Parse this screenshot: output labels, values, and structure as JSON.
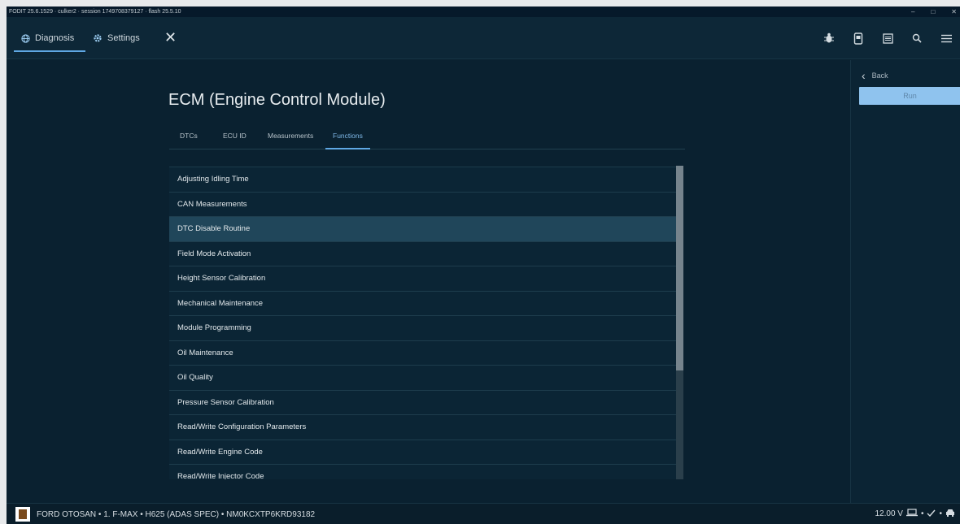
{
  "window": {
    "title": "FODIT 25.6.1529 · culker2 · session 1749708379127 · flash 25.5.10",
    "controls": {
      "minimize": "–",
      "maximize": "□",
      "close": "✕"
    }
  },
  "topbar": {
    "tabs": [
      {
        "label": "Diagnosis",
        "icon": "globe-icon"
      },
      {
        "label": "Settings",
        "icon": "gear-icon"
      }
    ],
    "close_label": "✕",
    "tool_icons": [
      "bug-icon",
      "device-icon",
      "document-icon",
      "search-icon",
      "menu-icon"
    ]
  },
  "page": {
    "title": "ECM (Engine Control Module)",
    "subtabs": [
      "DTCs",
      "ECU ID",
      "Measurements",
      "Functions"
    ],
    "active_subtab": "Functions"
  },
  "functions": {
    "selected": "DTC Disable Routine",
    "items": [
      "Adjusting Idling Time",
      "CAN Measurements",
      "DTC Disable Routine",
      "Field Mode Activation",
      "Height Sensor Calibration",
      "Mechanical Maintenance",
      "Module Programming",
      "Oil Maintenance",
      "Oil Quality",
      "Pressure Sensor Calibration",
      "Read/Write Configuration Parameters",
      "Read/Write Engine Code",
      "Read/Write Injector Code"
    ]
  },
  "right_panel": {
    "back_label": "Back",
    "run_label": "Run"
  },
  "statusbar": {
    "vehicle": "FORD OTOSAN • 1. F-MAX • H625 (ADAS SPEC) • NM0KCXTP6KRD93182",
    "voltage": "12.00 V",
    "icons": [
      "laptop-icon",
      "check-icon",
      "car-icon"
    ]
  },
  "colors": {
    "background": "#0a2130",
    "accent": "#5fa8e4",
    "run_button": "#8fc3ee",
    "selected_row": "#20465a"
  }
}
